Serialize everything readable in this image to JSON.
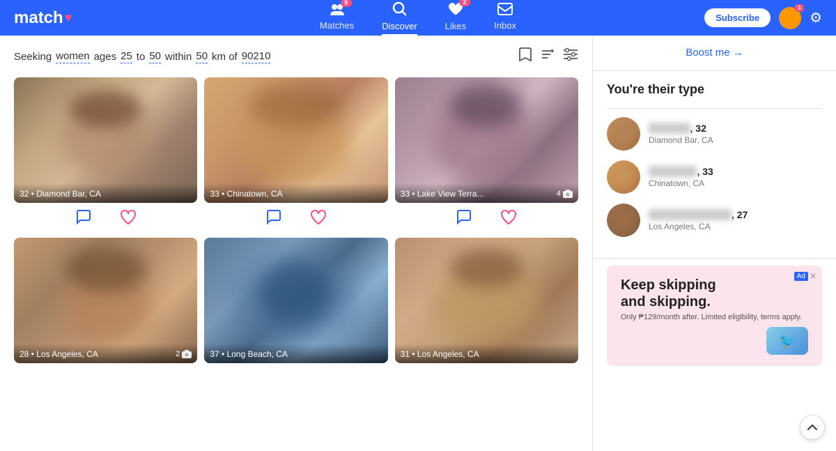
{
  "header": {
    "logo": "match",
    "logo_heart": "♥",
    "nav": [
      {
        "id": "matches",
        "label": "Matches",
        "badge": "9",
        "icon": "👥",
        "active": false
      },
      {
        "id": "discover",
        "label": "Discover",
        "badge": null,
        "icon": "🔍",
        "active": true
      },
      {
        "id": "likes",
        "label": "Likes",
        "badge": "2",
        "icon": "❤",
        "active": false
      },
      {
        "id": "inbox",
        "label": "Inbox",
        "badge": null,
        "icon": "✉",
        "active": false
      }
    ],
    "subscribe_label": "Subscribe",
    "avatar_initials": "",
    "avatar_badge": "3",
    "gear_icon": "⚙"
  },
  "search": {
    "seeking_label": "Seeking",
    "gender": "women",
    "ages_label": "ages",
    "min_age": "25",
    "to_label": "to",
    "max_age": "50",
    "within_label": "within",
    "distance": "50",
    "km_label": "km of",
    "zip": "90210"
  },
  "profiles": [
    {
      "age": "32",
      "location": "Diamond Bar, CA",
      "photo_count": null,
      "gradient": "img-gradient-1"
    },
    {
      "age": "33",
      "location": "Chinatown, CA",
      "photo_count": null,
      "gradient": "img-gradient-2"
    },
    {
      "age": "33",
      "location": "Lake View Terra...",
      "photo_count": "4",
      "gradient": "img-gradient-3"
    },
    {
      "age": "28",
      "location": "Los Angeles, CA",
      "photo_count": "2",
      "gradient": "img-gradient-4"
    },
    {
      "age": "37",
      "location": "Long Beach, CA",
      "photo_count": null,
      "gradient": "img-gradient-5"
    },
    {
      "age": "31",
      "location": "Los Angeles, CA",
      "photo_count": null,
      "gradient": "img-gradient-6"
    }
  ],
  "sidebar": {
    "boost_label": "Boost me →",
    "their_type_title": "You're their type",
    "type_persons": [
      {
        "name_blurred": "██████",
        "age": "32",
        "location": "Diamond Bar, CA",
        "avatar_gradient": "#c4956a"
      },
      {
        "name_blurred": "███████",
        "age": "33",
        "location": "Chinatown, CA",
        "avatar_gradient": "#d4a870"
      },
      {
        "name_blurred": "████████████",
        "age": "27",
        "location": "Los Angeles, CA",
        "avatar_gradient": "#b08060"
      }
    ],
    "ad": {
      "title": "Keep skipping\nand skipping.",
      "subtitle": "Only ₱129/month after. Limited eligibility, terms apply.",
      "ad_label": "Ad",
      "close_icon": "✕"
    }
  },
  "scroll_up_icon": "∧",
  "chat_icon": "💬",
  "heart_icon": "♡",
  "bookmark_icon": "🔖",
  "sort_icon": "⇅",
  "filter_icon": "⊞",
  "camera_icon": "📷"
}
